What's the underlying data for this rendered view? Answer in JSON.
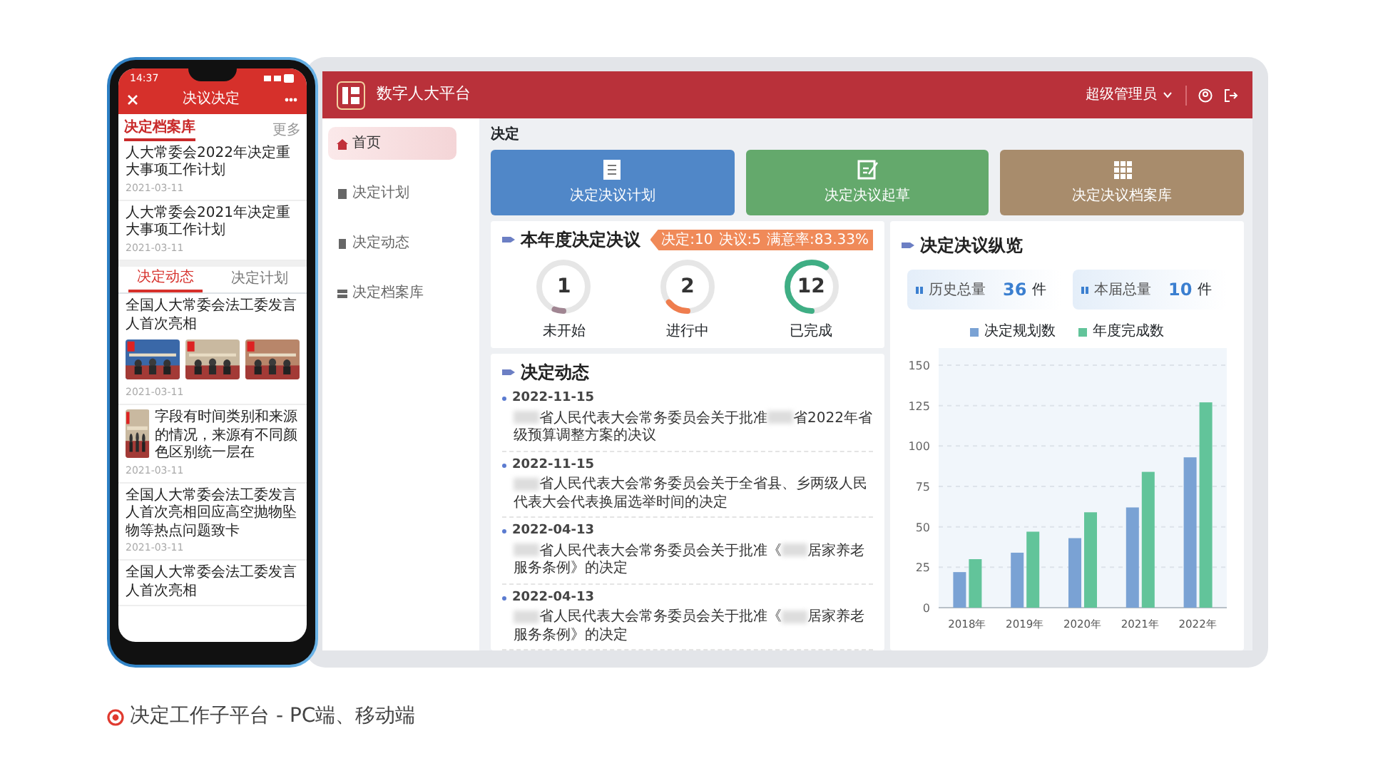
{
  "phone": {
    "status_time": "14:37",
    "header_title": "决议决定",
    "archive": {
      "title": "决定档案库",
      "more": "更多",
      "items": [
        {
          "title": "人大常委会2022年决定重大事项工作计划",
          "date": "2021-03-11"
        },
        {
          "title": "人大常委会2021年决定重大事项工作计划",
          "date": "2021-03-11"
        }
      ]
    },
    "tabs": [
      {
        "label": "决定动态",
        "selected": true
      },
      {
        "label": "决定计划",
        "selected": false
      }
    ],
    "news": [
      {
        "kind": "gallery",
        "title": "全国人大常委会法工委发言人首次亮相",
        "date": "2021-03-11"
      },
      {
        "kind": "thumb",
        "title": "字段有时间类别和来源的情况，来源有不同颜色区别统一层在",
        "date": "2021-03-11"
      },
      {
        "kind": "text",
        "title": "全国人大常委会法工委发言人首次亮相回应高空抛物坠物等热点问题致卡",
        "date": "2021-03-11"
      },
      {
        "kind": "text",
        "title": "全国人大常委会法工委发言人首次亮相"
      }
    ]
  },
  "desktop": {
    "app_title": "数字人大平台",
    "user": "超级管理员",
    "sidebar": {
      "items": [
        {
          "label": "首页",
          "selected": true
        },
        {
          "label": "决定计划",
          "selected": false
        },
        {
          "label": "决定动态",
          "selected": false
        },
        {
          "label": "决定档案库",
          "selected": false
        }
      ]
    },
    "page_title": "决定",
    "tiles": [
      {
        "label": "决定决议计划",
        "color": "#5087c8"
      },
      {
        "label": "决定决议起草",
        "color": "#64a96c"
      },
      {
        "label": "决定决议档案库",
        "color": "#a88c6c"
      }
    ],
    "annual": {
      "title": "本年度决定决议",
      "tag": [
        "决定:10",
        "决议:5",
        "满意率:83.33%"
      ],
      "rings": [
        {
          "value": "1",
          "label": "未开始",
          "level": 0.06,
          "color": "#a08592"
        },
        {
          "value": "2",
          "label": "进行中",
          "level": 0.14,
          "color": "#ef7d4e"
        },
        {
          "value": "12",
          "label": "已完成",
          "level": 0.6,
          "color": "#3fae84"
        }
      ]
    },
    "news": {
      "title": "决定动态",
      "items": [
        {
          "date": "2022-11-15",
          "segments": [
            {
              "kind": "blur"
            },
            {
              "kind": "text",
              "text": "省人民代表大会常务委员会关于批准"
            },
            {
              "kind": "blur"
            },
            {
              "kind": "text",
              "text": "省2022年省级预算调整方案的决议"
            }
          ]
        },
        {
          "date": "2022-11-15",
          "segments": [
            {
              "kind": "blur"
            },
            {
              "kind": "text",
              "text": "省人民代表大会常务委员会关于全省县、乡两级人民代表大会代表换届选举时间的决定"
            }
          ]
        },
        {
          "date": "2022-04-13",
          "segments": [
            {
              "kind": "blur"
            },
            {
              "kind": "text",
              "text": "省人民代表大会常务委员会关于批准《"
            },
            {
              "kind": "blur"
            },
            {
              "kind": "text",
              "text": "居家养老服务条例》的决定"
            }
          ]
        },
        {
          "date": "2022-04-13",
          "segments": [
            {
              "kind": "blur"
            },
            {
              "kind": "text",
              "text": "省人民代表大会常务委员会关于批准《"
            },
            {
              "kind": "blur"
            },
            {
              "kind": "text",
              "text": "居家养老服务条例》的决定"
            }
          ]
        }
      ]
    },
    "overview": {
      "title": "决定决议纵览",
      "stats": [
        {
          "label": "历史总量",
          "value": "36",
          "unit": "件"
        },
        {
          "label": "本届总量",
          "value": "10",
          "unit": "件"
        }
      ],
      "chart_data": {
        "type": "bar",
        "categories": [
          "2018年",
          "2019年",
          "2020年",
          "2021年",
          "2022年"
        ],
        "series": [
          {
            "name": "决定规划数",
            "color": "#7aa2d4",
            "values": [
              22,
              34,
              43,
              62,
              93
            ]
          },
          {
            "name": "年度完成数",
            "color": "#62c49a",
            "values": [
              30,
              47,
              59,
              84,
              127
            ]
          }
        ],
        "ylim": [
          0,
          150
        ],
        "yticks": [
          0,
          25,
          50,
          75,
          100,
          125,
          150
        ],
        "grid": true
      }
    }
  },
  "caption": "决定工作子平台 - PC端、移动端"
}
